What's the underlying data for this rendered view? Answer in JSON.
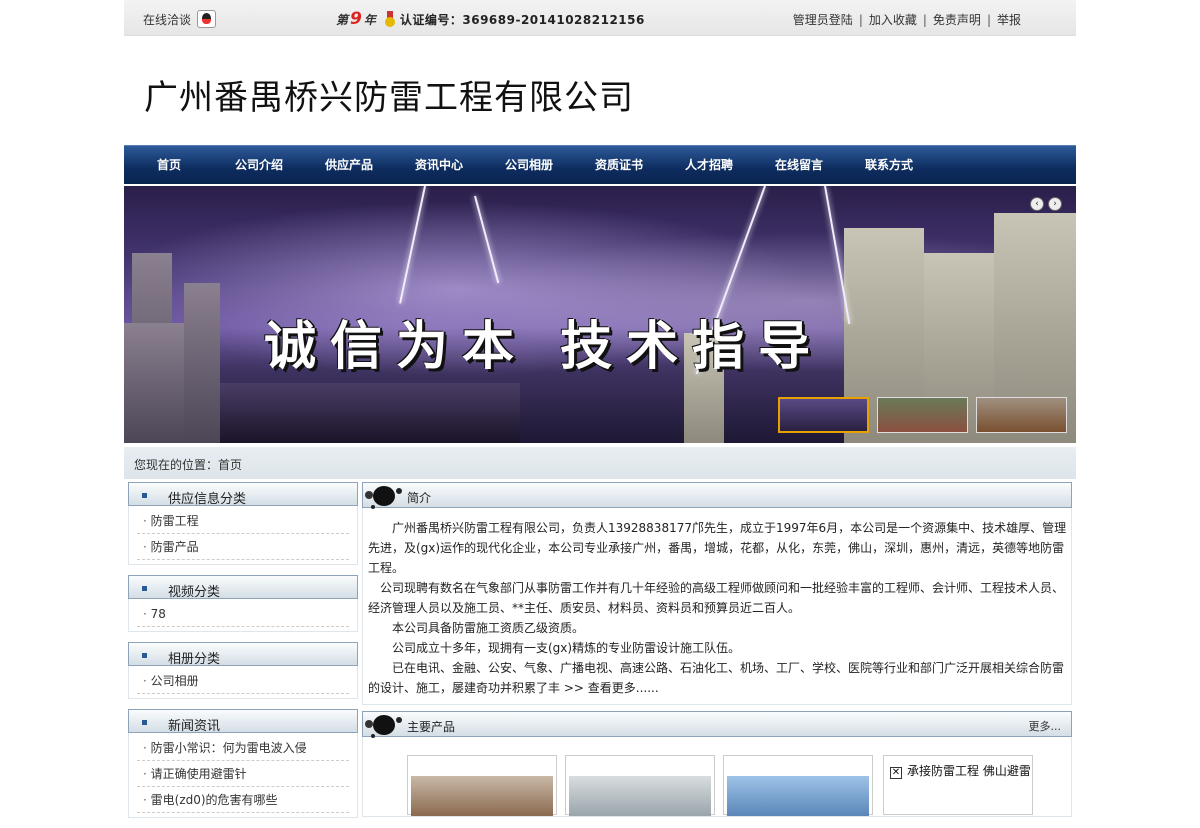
{
  "topbar": {
    "online_chat": "在线洽谈",
    "year_prefix": "第",
    "year_num": "9",
    "year_suffix": "年",
    "cert": "认证编号：369689-20141028212156",
    "links": [
      "管理员登陆",
      "加入收藏",
      "免责声明",
      "举报"
    ]
  },
  "header": {
    "company_name": "广州番禺桥兴防雷工程有限公司"
  },
  "nav": {
    "items": [
      "首页",
      "公司介绍",
      "供应产品",
      "资讯中心",
      "公司相册",
      "资质证书",
      "人才招聘",
      "在线留言",
      "联系方式"
    ]
  },
  "banner": {
    "slogan": "诚信为本  技术指导",
    "prev": "‹",
    "next": "›"
  },
  "breadcrumb": "您现在的位置：首页",
  "sidebar": [
    {
      "title": "供应信息分类",
      "items": [
        "防雷工程",
        "防雷产品"
      ]
    },
    {
      "title": "视频分类",
      "items": [
        "78"
      ]
    },
    {
      "title": "相册分类",
      "items": [
        "公司相册"
      ]
    },
    {
      "title": "新闻资讯",
      "items": [
        "防雷小常识：何为雷电波入侵",
        "请正确使用避雷针",
        "雷电(zd0)的危害有哪些"
      ]
    }
  ],
  "intro": {
    "title": "简介",
    "paragraphs": [
      "　　广州番禺桥兴防雷工程有限公司，负责人13928838177邝先生，成立于1997年6月，本公司是一个资源集中、技术雄厚、管理先进，及(gx)运作的现代化企业，本公司专业承接广州，番禺，增城，花都，从化，东莞，佛山，深圳，惠州，清远，英德等地防雷工程。",
      "　公司现聘有数名在气象部门从事防雷工作并有几十年经验的高级工程师做顾问和一批经验丰富的工程师、会计师、工程技术人员、经济管理人员以及施工员、**主任、质安员、材料员、资料员和预算员近二百人。",
      "　　本公司具备防雷施工资质乙级资质。",
      "　　公司成立十多年，现拥有一支(gx)精炼的专业防雷设计施工队伍。",
      "　　已在电讯、金融、公安、气象、广播电视、高速公路、石油化工、机场、工厂、学校、医院等行业和部门广泛开展相关综合防雷的设计、施工，屡建奇功并积累了丰"
    ],
    "more": ">> 查看更多......"
  },
  "products": {
    "title": "主要产品",
    "more": "更多...",
    "popup_text": "承接防雷工程 佛山避雷"
  }
}
